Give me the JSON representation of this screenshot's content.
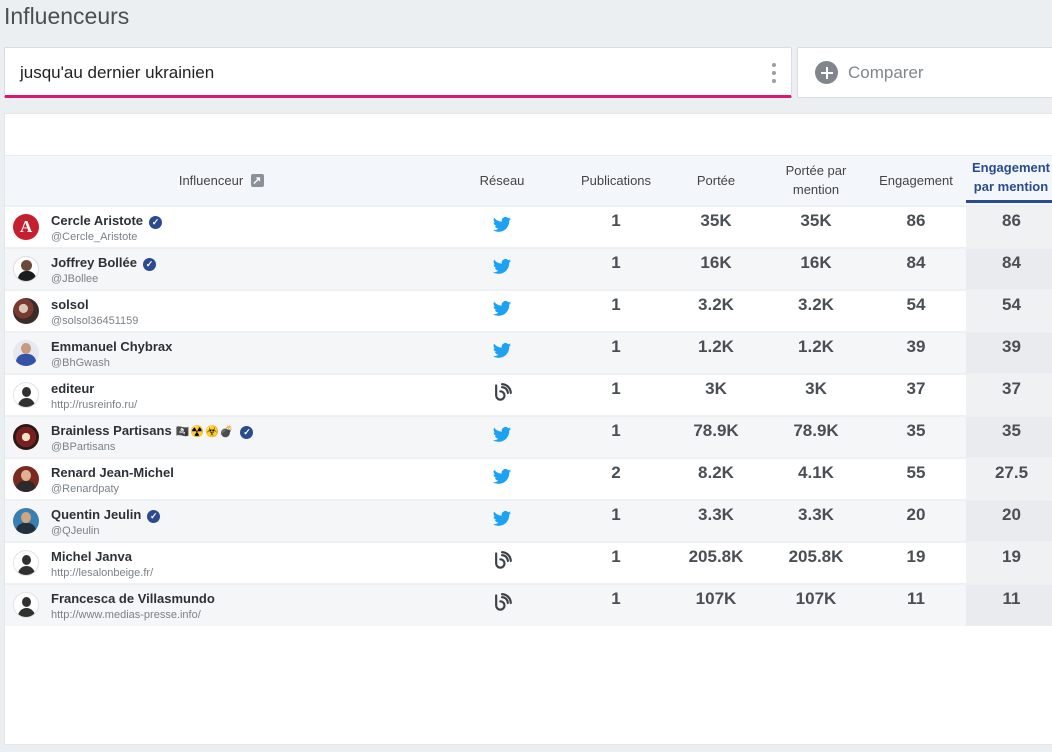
{
  "page": {
    "title": "Influenceurs"
  },
  "query": {
    "text": "jusqu'au dernier ukrainien"
  },
  "compare": {
    "label": "Comparer"
  },
  "colors": {
    "accent": "#d81b72",
    "brand": "#2a4b8d",
    "twitter": "#1da1f2"
  },
  "table": {
    "headers": {
      "influencer": "Influenceur",
      "network": "Réseau",
      "publications": "Publications",
      "reach": "Portée",
      "reach_per_mention": "Portée par mention",
      "engagement": "Engagement",
      "engagement_per_mention": "Engagement par mention"
    },
    "sorted_by": "engagement_per_mention",
    "rows": [
      {
        "name": "Cercle Aristote",
        "handle": "@Cercle_Aristote",
        "verified": true,
        "network": "twitter",
        "avatar": "ca",
        "emojis": "",
        "publications": "1",
        "reach": "35K",
        "reach_per_mention": "35K",
        "engagement": "86",
        "engagement_per_mention": "86"
      },
      {
        "name": "Joffrey Bollée",
        "handle": "@JBollee",
        "verified": true,
        "network": "twitter",
        "avatar": "jb",
        "emojis": "",
        "publications": "1",
        "reach": "16K",
        "reach_per_mention": "16K",
        "engagement": "84",
        "engagement_per_mention": "84"
      },
      {
        "name": "solsol",
        "handle": "@solsol36451159",
        "verified": false,
        "network": "twitter",
        "avatar": "ss",
        "emojis": "",
        "publications": "1",
        "reach": "3.2K",
        "reach_per_mention": "3.2K",
        "engagement": "54",
        "engagement_per_mention": "54"
      },
      {
        "name": "Emmanuel Chybrax",
        "handle": "@BhGwash",
        "verified": false,
        "network": "twitter",
        "avatar": "ec",
        "emojis": "",
        "publications": "1",
        "reach": "1.2K",
        "reach_per_mention": "1.2K",
        "engagement": "39",
        "engagement_per_mention": "39"
      },
      {
        "name": "editeur",
        "handle": "http://rusreinfo.ru/",
        "verified": false,
        "network": "blog",
        "avatar": "def",
        "emojis": "",
        "publications": "1",
        "reach": "3K",
        "reach_per_mention": "3K",
        "engagement": "37",
        "engagement_per_mention": "37"
      },
      {
        "name": "Brainless Partisans",
        "handle": "@BPartisans",
        "verified": true,
        "network": "twitter",
        "avatar": "bp",
        "emojis": "🏴‍☠️☢️☣️💣",
        "publications": "1",
        "reach": "78.9K",
        "reach_per_mention": "78.9K",
        "engagement": "35",
        "engagement_per_mention": "35"
      },
      {
        "name": "Renard Jean-Michel",
        "handle": "@Renardpaty",
        "verified": false,
        "network": "twitter",
        "avatar": "rj",
        "emojis": "",
        "publications": "2",
        "reach": "8.2K",
        "reach_per_mention": "4.1K",
        "engagement": "55",
        "engagement_per_mention": "27.5"
      },
      {
        "name": "Quentin Jeulin",
        "handle": "@QJeulin",
        "verified": true,
        "network": "twitter",
        "avatar": "qj",
        "emojis": "",
        "publications": "1",
        "reach": "3.3K",
        "reach_per_mention": "3.3K",
        "engagement": "20",
        "engagement_per_mention": "20"
      },
      {
        "name": "Michel Janva",
        "handle": "http://lesalonbeige.fr/",
        "verified": false,
        "network": "blog",
        "avatar": "def",
        "emojis": "",
        "publications": "1",
        "reach": "205.8K",
        "reach_per_mention": "205.8K",
        "engagement": "19",
        "engagement_per_mention": "19"
      },
      {
        "name": "Francesca de Villasmundo",
        "handle": "http://www.medias-presse.info/",
        "verified": false,
        "network": "blog",
        "avatar": "def",
        "emojis": "",
        "publications": "1",
        "reach": "107K",
        "reach_per_mention": "107K",
        "engagement": "11",
        "engagement_per_mention": "11"
      }
    ]
  }
}
